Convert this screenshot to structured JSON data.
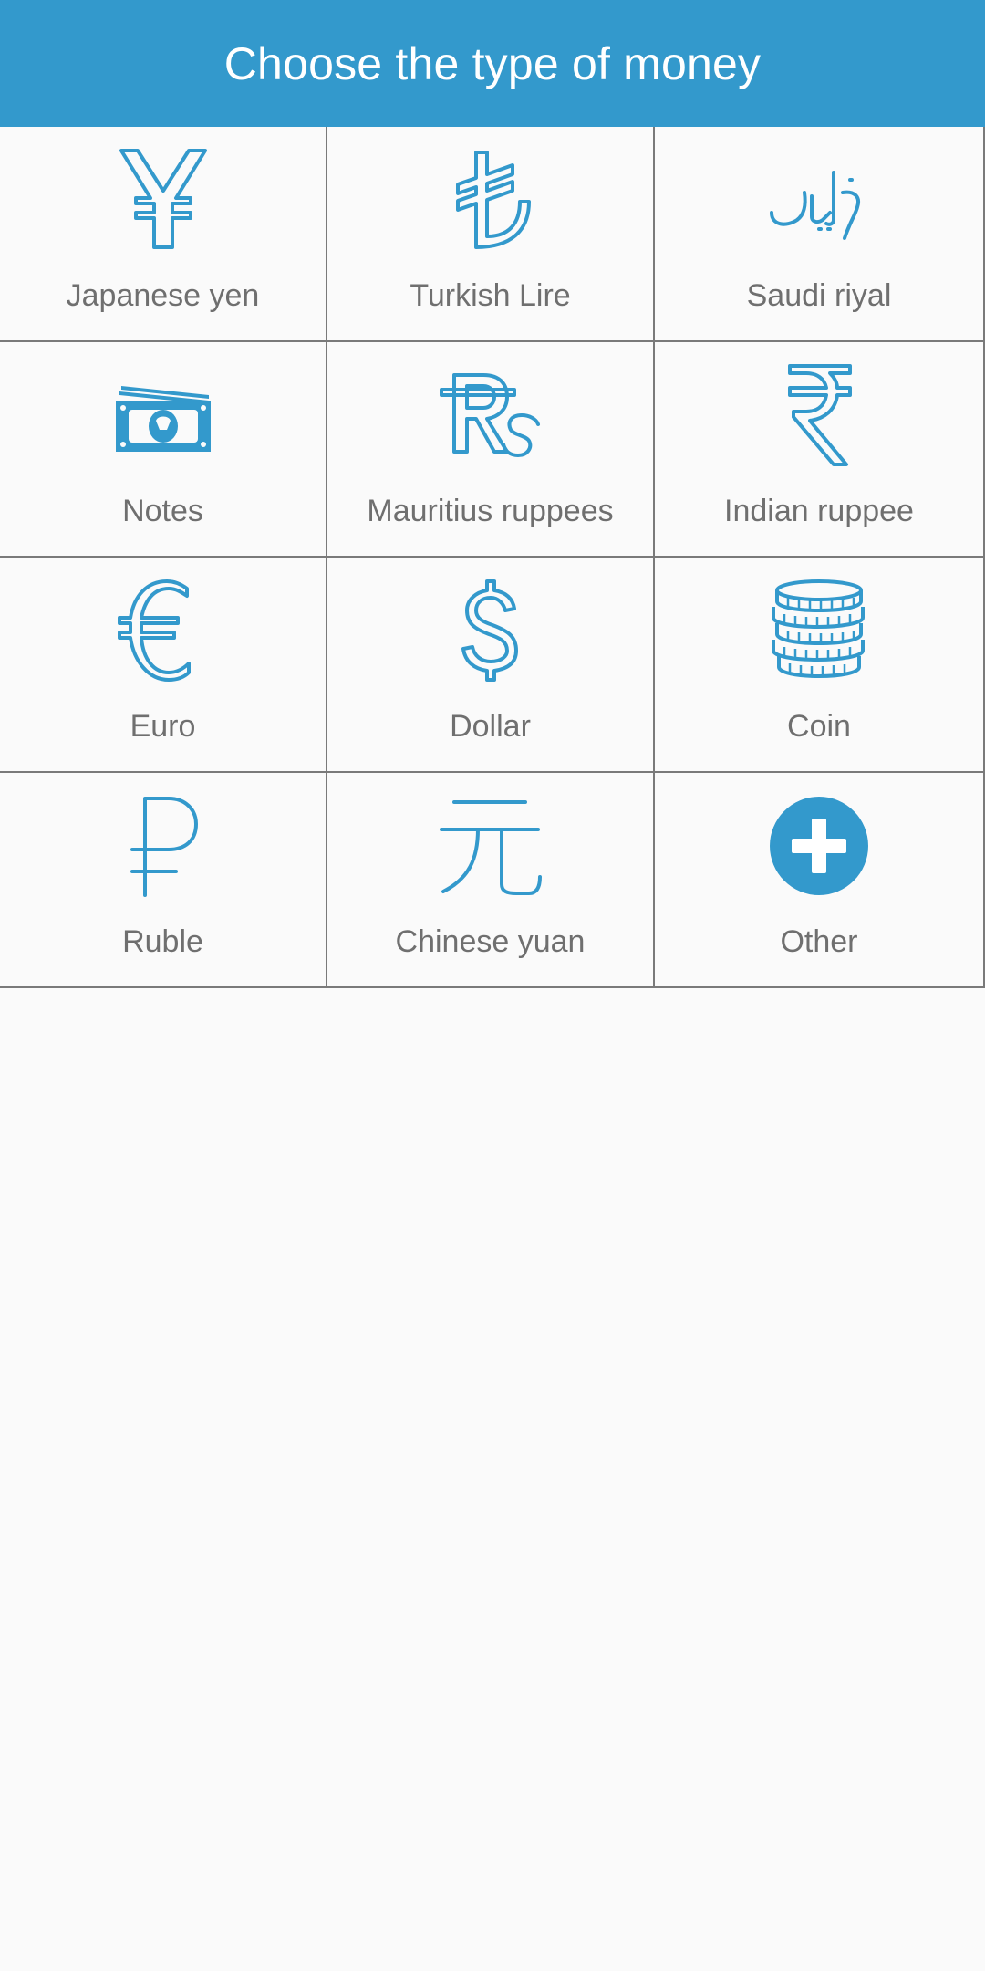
{
  "header": {
    "title": "Choose the type of money"
  },
  "colors": {
    "accent": "#3399cc",
    "label": "#6f6f6f",
    "grid_line": "#7a7a7a",
    "background": "#fafafa"
  },
  "money_types": [
    {
      "label": "Japanese yen",
      "icon": "yen-icon"
    },
    {
      "label": "Turkish Lire",
      "icon": "lira-icon"
    },
    {
      "label": "Saudi riyal",
      "icon": "riyal-icon"
    },
    {
      "label": "Notes",
      "icon": "banknotes-icon"
    },
    {
      "label": "Mauritius ruppees",
      "icon": "rupee-rs-icon"
    },
    {
      "label": "Indian ruppee",
      "icon": "indian-rupee-icon"
    },
    {
      "label": "Euro",
      "icon": "euro-icon"
    },
    {
      "label": "Dollar",
      "icon": "dollar-icon"
    },
    {
      "label": "Coin",
      "icon": "coins-icon"
    },
    {
      "label": "Ruble",
      "icon": "ruble-icon"
    },
    {
      "label": "Chinese yuan",
      "icon": "yuan-icon"
    },
    {
      "label": "Other",
      "icon": "plus-circle-icon"
    }
  ]
}
